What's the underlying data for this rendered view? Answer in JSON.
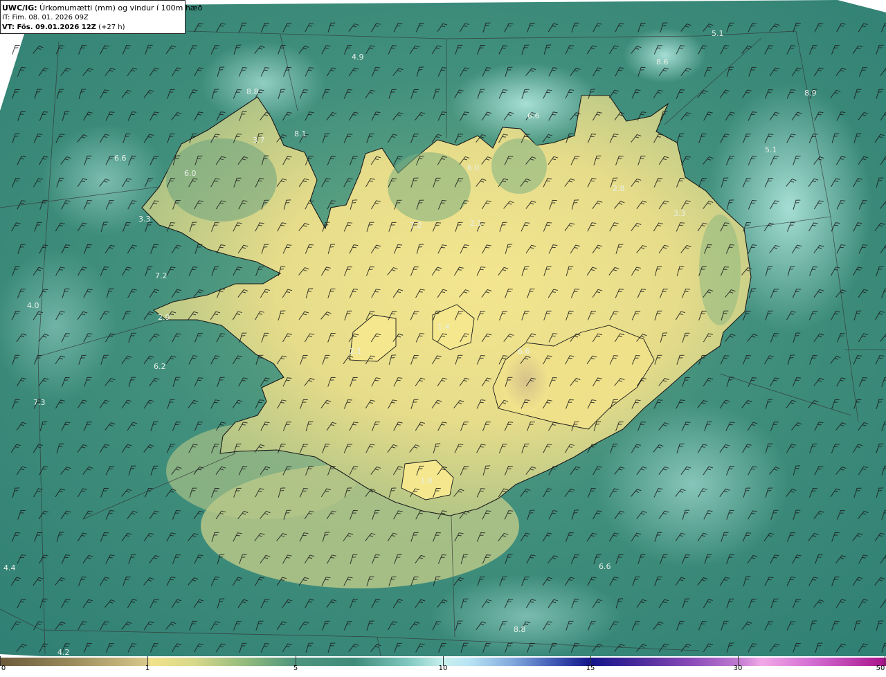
{
  "header": {
    "line1_bold": "UWC/IG:",
    "line1_rest": " Úrkomumætti (mm) og vindur í 100m hæð",
    "line2": "IT: Fim. 08. 01. 2026 09Z",
    "line3_bold": "VT: Fös. 09.01.2026 12Z",
    "line3_rest": " (+27 h)"
  },
  "map_labels": [
    "5.1",
    "4.9",
    "8.6",
    "8.9",
    "8.8",
    "6.6",
    "3.7",
    "8.1",
    "5.1",
    "6.6",
    "6.0",
    "6.0",
    "2.8",
    "3.3",
    "3.3",
    "7.2",
    "2.1",
    "7.2",
    "4.0",
    "2.9",
    "1.4",
    "6.6",
    "2.1",
    "6.2",
    "7.3",
    "1.8",
    "6.6",
    "4.4",
    "4.2",
    "8.8"
  ],
  "colorbar": {
    "ticks": [
      "0",
      "1",
      "5",
      "10",
      "15",
      "30",
      "50"
    ]
  },
  "colors": {
    "sea": "#3f8c7a",
    "land_low": "#c8d08a",
    "land_high": "#f0e48c",
    "coast": "#1a1a1a"
  }
}
